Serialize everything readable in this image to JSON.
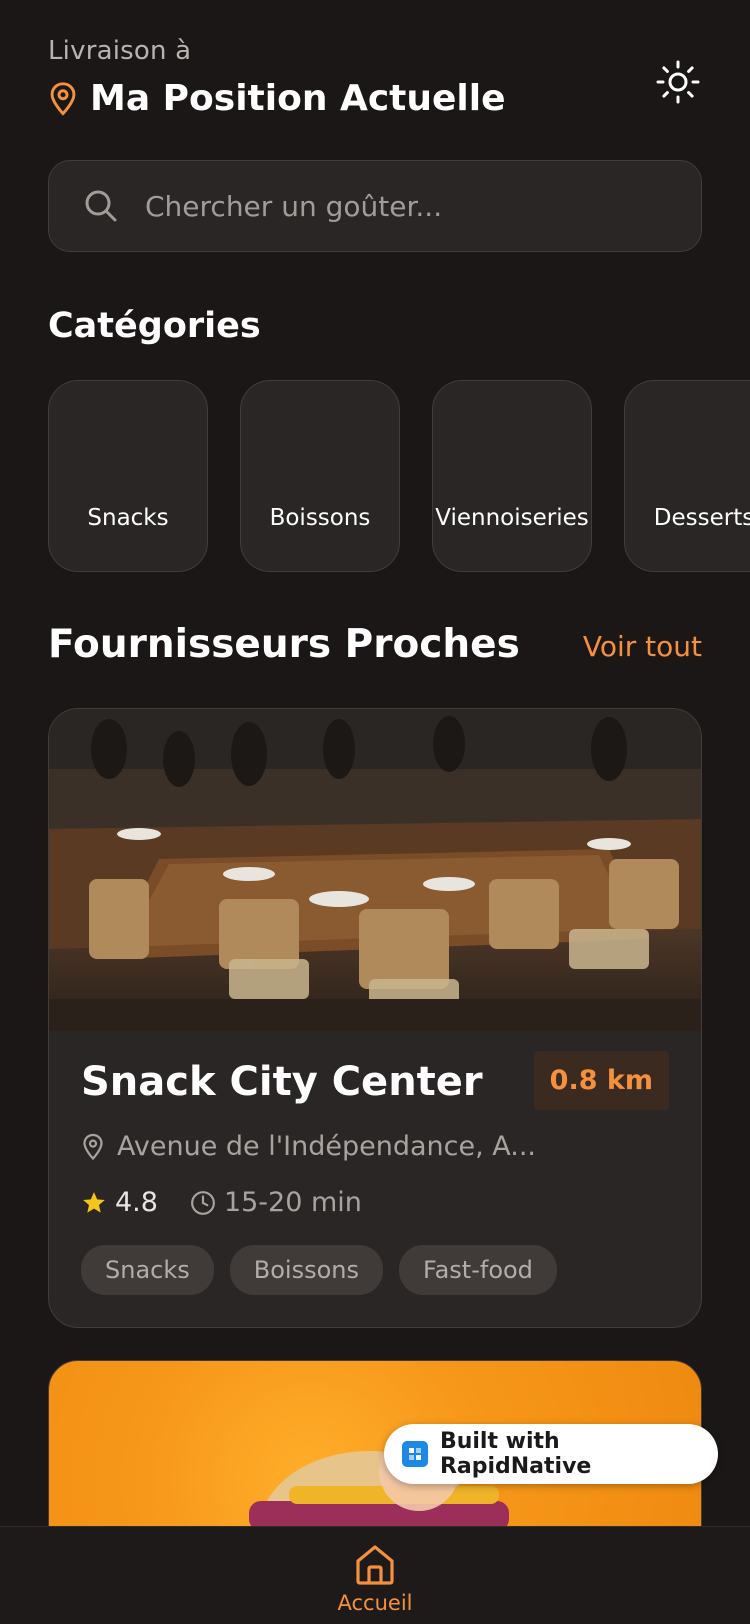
{
  "header": {
    "deliver_label": "Livraison à",
    "location": "Ma Position Actuelle",
    "theme_icon": "sun-icon"
  },
  "search": {
    "placeholder": "Chercher un goûter..."
  },
  "categories": {
    "title": "Catégories",
    "items": [
      {
        "label": "Snacks"
      },
      {
        "label": "Boissons"
      },
      {
        "label": "Viennoiseries"
      },
      {
        "label": "Desserts"
      }
    ]
  },
  "nearby": {
    "title": "Fournisseurs Proches",
    "see_all": "Voir tout"
  },
  "providers": [
    {
      "name": "Snack City Center",
      "distance": "0.8 km",
      "address": "Avenue de l'Indépendance, A...",
      "rating": "4.8",
      "time": "15-20 min",
      "tags": [
        "Snacks",
        "Boissons",
        "Fast-food"
      ]
    }
  ],
  "badge": {
    "text": "Built with RapidNative"
  },
  "tabbar": {
    "home_label": "Accueil"
  },
  "colors": {
    "accent": "#f5913e",
    "background": "#1b1716",
    "card": "#2a2625",
    "star": "#f5c518"
  }
}
